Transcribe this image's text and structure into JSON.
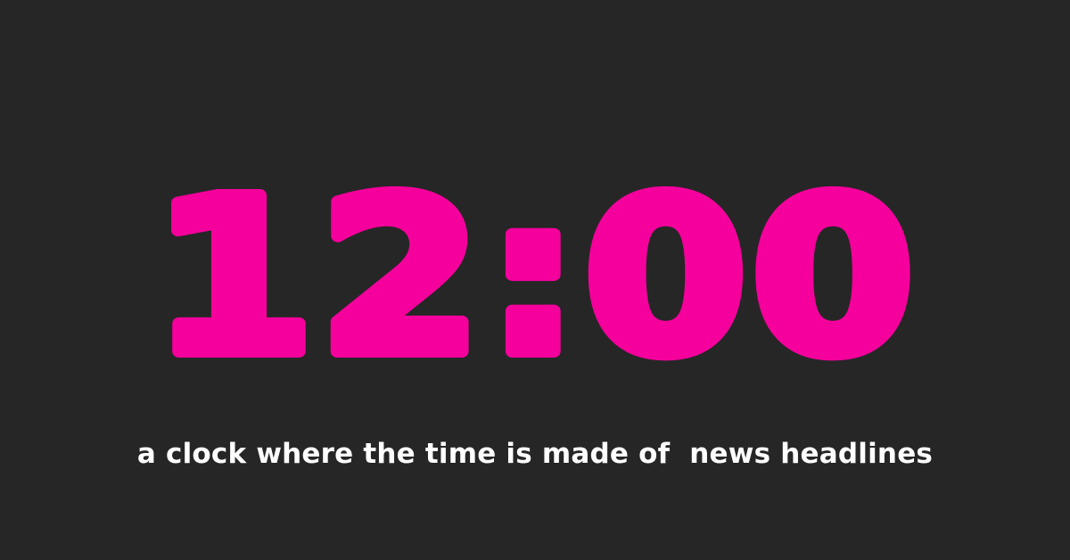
{
  "clock": {
    "time": "12:00",
    "color": "#f5009c"
  },
  "tagline": "a clock where the time is made of  news headlines",
  "colors": {
    "background": "#262626",
    "tagline": "#ffffff"
  }
}
